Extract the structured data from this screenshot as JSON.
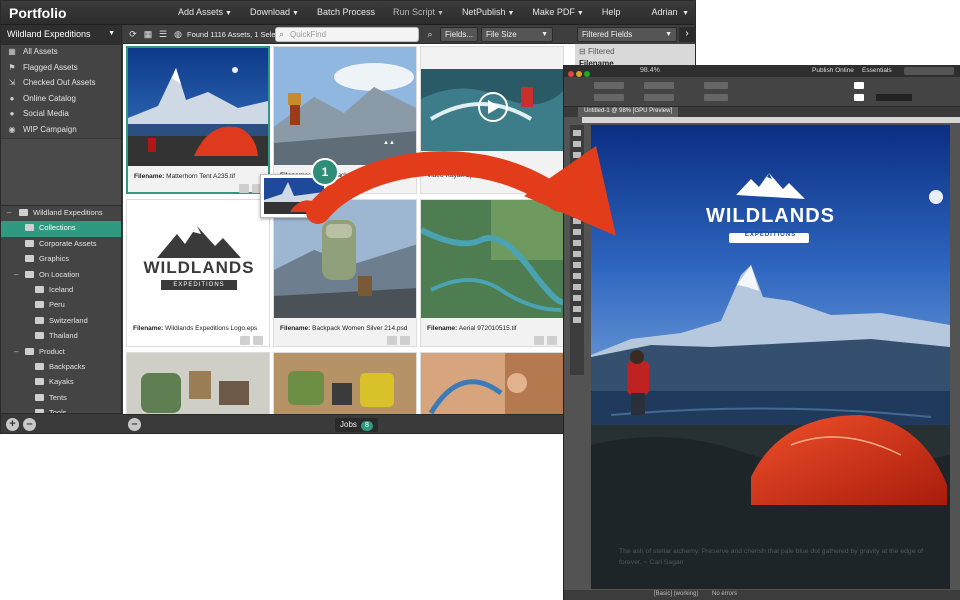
{
  "portfolio": {
    "logo": "Portfolio",
    "menu": [
      {
        "label": "Add Assets",
        "caret": "▼"
      },
      {
        "label": "Download",
        "caret": "▼"
      },
      {
        "label": "Batch Process",
        "caret": ""
      },
      {
        "label": "Run Script",
        "caret": "▼"
      },
      {
        "label": "NetPublish",
        "caret": "▼"
      },
      {
        "label": "Make PDF",
        "caret": "▼"
      },
      {
        "label": "Help",
        "caret": ""
      }
    ],
    "user": "Adrian",
    "user_caret": "▼",
    "sidebar": {
      "catalog": "Wildland Expeditions",
      "items": [
        "All Assets",
        "Flagged Assets",
        "Checked Out Assets",
        "Online Catalog",
        "Social Media",
        "WIP Campaign"
      ],
      "tree": [
        {
          "label": "Wildland Expeditions",
          "level": 0,
          "twisty": "–"
        },
        {
          "label": "Collections",
          "level": 1,
          "twisty": ""
        },
        {
          "label": "Corporate Assets",
          "level": 1,
          "twisty": ""
        },
        {
          "label": "Graphics",
          "level": 1,
          "twisty": ""
        },
        {
          "label": "On Location",
          "level": 1,
          "twisty": "–"
        },
        {
          "label": "Iceland",
          "level": 2,
          "twisty": ""
        },
        {
          "label": "Peru",
          "level": 2,
          "twisty": ""
        },
        {
          "label": "Switzerland",
          "level": 2,
          "twisty": ""
        },
        {
          "label": "Thailand",
          "level": 2,
          "twisty": ""
        },
        {
          "label": "Product",
          "level": 1,
          "twisty": "–"
        },
        {
          "label": "Backpacks",
          "level": 2,
          "twisty": ""
        },
        {
          "label": "Kayaks",
          "level": 2,
          "twisty": ""
        },
        {
          "label": "Tents",
          "level": 2,
          "twisty": ""
        },
        {
          "label": "Tools",
          "level": 2,
          "twisty": ""
        }
      ],
      "selected_tree_item": "Collections",
      "add_label": "+",
      "remove_label": "–"
    },
    "toolbar": {
      "found": "Found 1116 Assets, 1 Selec...",
      "quickfind_placeholder": "QuickFind",
      "fields_button": "Fields...",
      "sort_field": "File Size",
      "filter_menu": "Filtered Fields",
      "panel_heading": "Filtered",
      "panel_field": "Filename"
    },
    "caption_prefix": "Filename:",
    "assets": [
      {
        "filename": "Matterhorn Tent A235.tif",
        "selected": true
      },
      {
        "filename": "... Backpack 2017.psd",
        "selected": false
      },
      {
        "filename": "Video-Kayak Splash.mov",
        "selected": false
      },
      {
        "filename": "Wildlands Expeditions Logo.eps",
        "selected": false
      },
      {
        "filename": "Backpack Women Silver 214.psd",
        "selected": false
      },
      {
        "filename": "Aerial 972010515.tif",
        "selected": false
      },
      {
        "filename": "",
        "selected": false
      },
      {
        "filename": "",
        "selected": false
      },
      {
        "filename": "",
        "selected": false
      }
    ],
    "logo_card": {
      "brand": "WILDLANDS",
      "sub": "EXPEDITIONS"
    },
    "jobs": {
      "label": "Jobs",
      "count": "8"
    },
    "step_badge": "1"
  },
  "indesign": {
    "zoom": "98.4%",
    "publish": "Publish Online",
    "workspace": "Essentials",
    "doc_tab": "Untitled-1 @ 98% [GPU Preview]",
    "brand": "WILDLANDS",
    "brand_sub": "EXPEDITIONS",
    "quote": "The ash of stellar alchemy. Preserve and cherish that pale blue dot gathered by gravity at the edge of forever. ~ Carl Sagan",
    "status_style": "[Basic] (working)",
    "status_errors": "No errors"
  },
  "colors": {
    "accent": "#2f9a80",
    "arrow": "#e23c1b",
    "tent": "#e03a1e"
  },
  "icons": [
    "refresh-icon",
    "grid-view-icon",
    "list-view-icon",
    "globe-icon",
    "search-icon",
    "gear-icon",
    "chevron-right-icon",
    "play-icon",
    "flag-icon",
    "lock-icon",
    "video-icon",
    "folder-icon",
    "user-icon",
    "plus-icon",
    "minus-icon"
  ]
}
